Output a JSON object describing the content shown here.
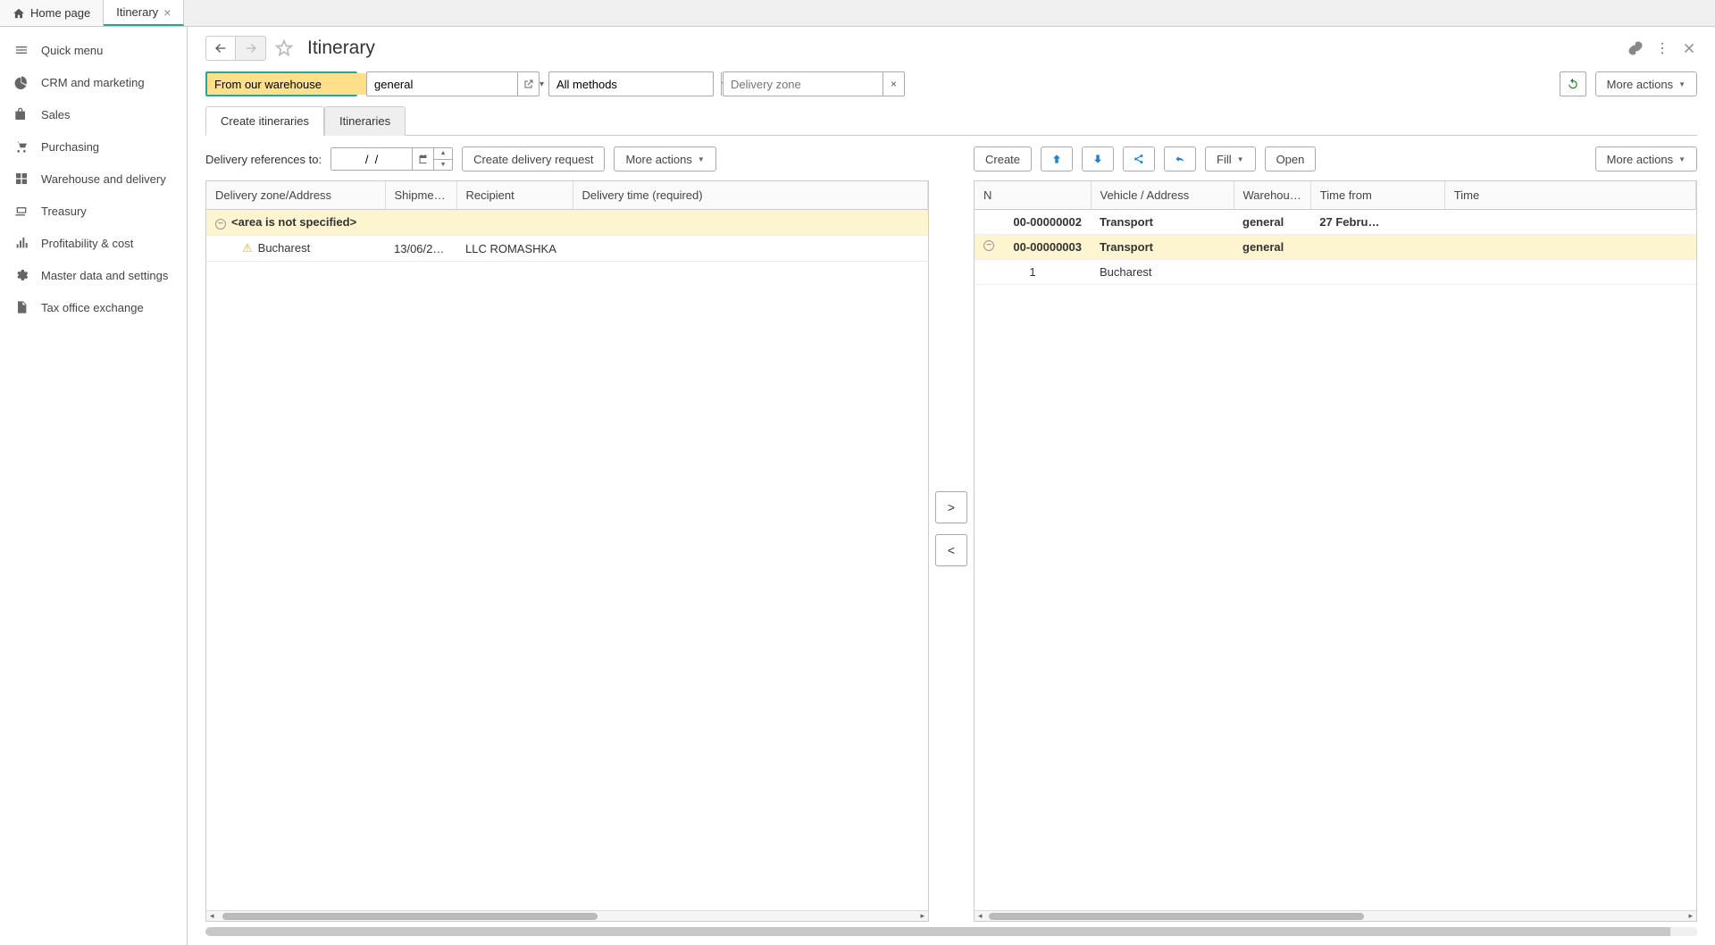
{
  "tabs": [
    {
      "label": "Home page",
      "icon": "home"
    },
    {
      "label": "Itinerary",
      "active": true,
      "closable": true
    }
  ],
  "sidebar": [
    {
      "label": "Quick menu",
      "icon": "menu"
    },
    {
      "label": "CRM and marketing",
      "icon": "pie"
    },
    {
      "label": "Sales",
      "icon": "bag"
    },
    {
      "label": "Purchasing",
      "icon": "cart"
    },
    {
      "label": "Warehouse and delivery",
      "icon": "grid"
    },
    {
      "label": "Treasury",
      "icon": "cash"
    },
    {
      "label": "Profitability & cost",
      "icon": "bars"
    },
    {
      "label": "Master data and settings",
      "icon": "gear"
    },
    {
      "label": "Tax office exchange",
      "icon": "doc"
    }
  ],
  "page_title": "Itinerary",
  "filters": {
    "warehouse": "From our warehouse",
    "general": "general",
    "methods": "All methods",
    "zone_placeholder": "Delivery zone"
  },
  "header_buttons": {
    "more_actions": "More actions"
  },
  "section_tabs": [
    "Create itineraries",
    "Itineraries"
  ],
  "left_toolbar": {
    "label": "Delivery references to:",
    "date": "/  /",
    "create_delivery": "Create delivery request",
    "more": "More actions"
  },
  "left_table": {
    "columns": [
      "Delivery zone/Address",
      "Shipme…",
      "Recipient",
      "Delivery time (required)"
    ],
    "group": "<area is not specified>",
    "rows": [
      {
        "zone": "Bucharest",
        "shipment": "13/06/2…",
        "recipient": "LLC ROMASHKA",
        "time": ""
      }
    ]
  },
  "mid": {
    "right": ">",
    "left": "<"
  },
  "right_toolbar": {
    "create": "Create",
    "fill": "Fill",
    "open": "Open",
    "more": "More actions"
  },
  "right_table": {
    "columns": [
      "N",
      "Vehicle / Address",
      "Warehou…",
      "Time from",
      "Time"
    ],
    "rows": [
      {
        "n": "00-00000002",
        "vehicle": "Transport",
        "wh": "general",
        "time": "27 Febru…",
        "bold": true
      },
      {
        "n": "00-00000003",
        "vehicle": "Transport",
        "wh": "general",
        "time": "",
        "bold": true,
        "group": true,
        "selected": true
      },
      {
        "n": "1",
        "vehicle": "Bucharest",
        "wh": "",
        "time": ""
      }
    ]
  }
}
